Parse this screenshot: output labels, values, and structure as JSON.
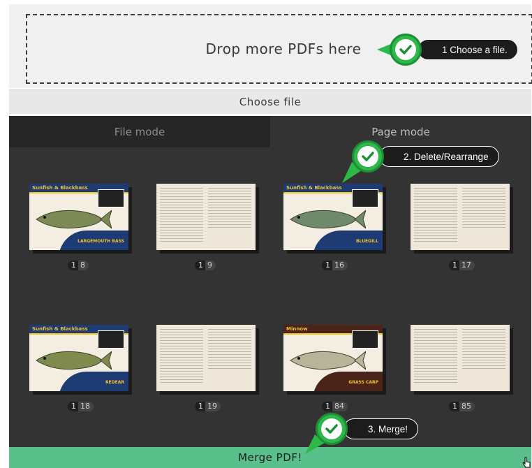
{
  "drop_zone": {
    "text": "Drop more PDFs here"
  },
  "choose_file": {
    "label": "Choose file"
  },
  "tabs": [
    {
      "label": "File mode",
      "active": false
    },
    {
      "label": "Page mode",
      "active": true
    }
  ],
  "pages": [
    {
      "kind": "cover",
      "title": "Sunfish & Blackbass",
      "name": "LARGEMOUTH BASS",
      "file": "1",
      "page": "8",
      "fish_color": "#7c8a55"
    },
    {
      "kind": "text",
      "file": "1",
      "page": "9"
    },
    {
      "kind": "cover",
      "title": "Sunfish & Blackbass",
      "name": "BLUEGILL",
      "file": "1",
      "page": "16",
      "fish_color": "#6f8a6a"
    },
    {
      "kind": "text",
      "file": "1",
      "page": "17"
    },
    {
      "kind": "cover",
      "title": "Sunfish & Blackbass",
      "name": "REDEAR",
      "file": "1",
      "page": "18",
      "fish_color": "#7f8a4d"
    },
    {
      "kind": "text",
      "file": "1",
      "page": "19"
    },
    {
      "kind": "cover",
      "title": "Minnow",
      "name": "GRASS CARP",
      "file": "1",
      "page": "84",
      "fish_color": "#b8b49a",
      "dark": true
    },
    {
      "kind": "text",
      "file": "1",
      "page": "85"
    }
  ],
  "merge": {
    "label": "Merge PDF!"
  },
  "callouts": [
    {
      "text": "1 Choose a file."
    },
    {
      "text": "2. Delete/Rearrange"
    },
    {
      "text": "3. Merge!"
    }
  ],
  "colors": {
    "accent_green": "#59c08c",
    "check_green": "#2db84a",
    "workspace": "#333333"
  }
}
